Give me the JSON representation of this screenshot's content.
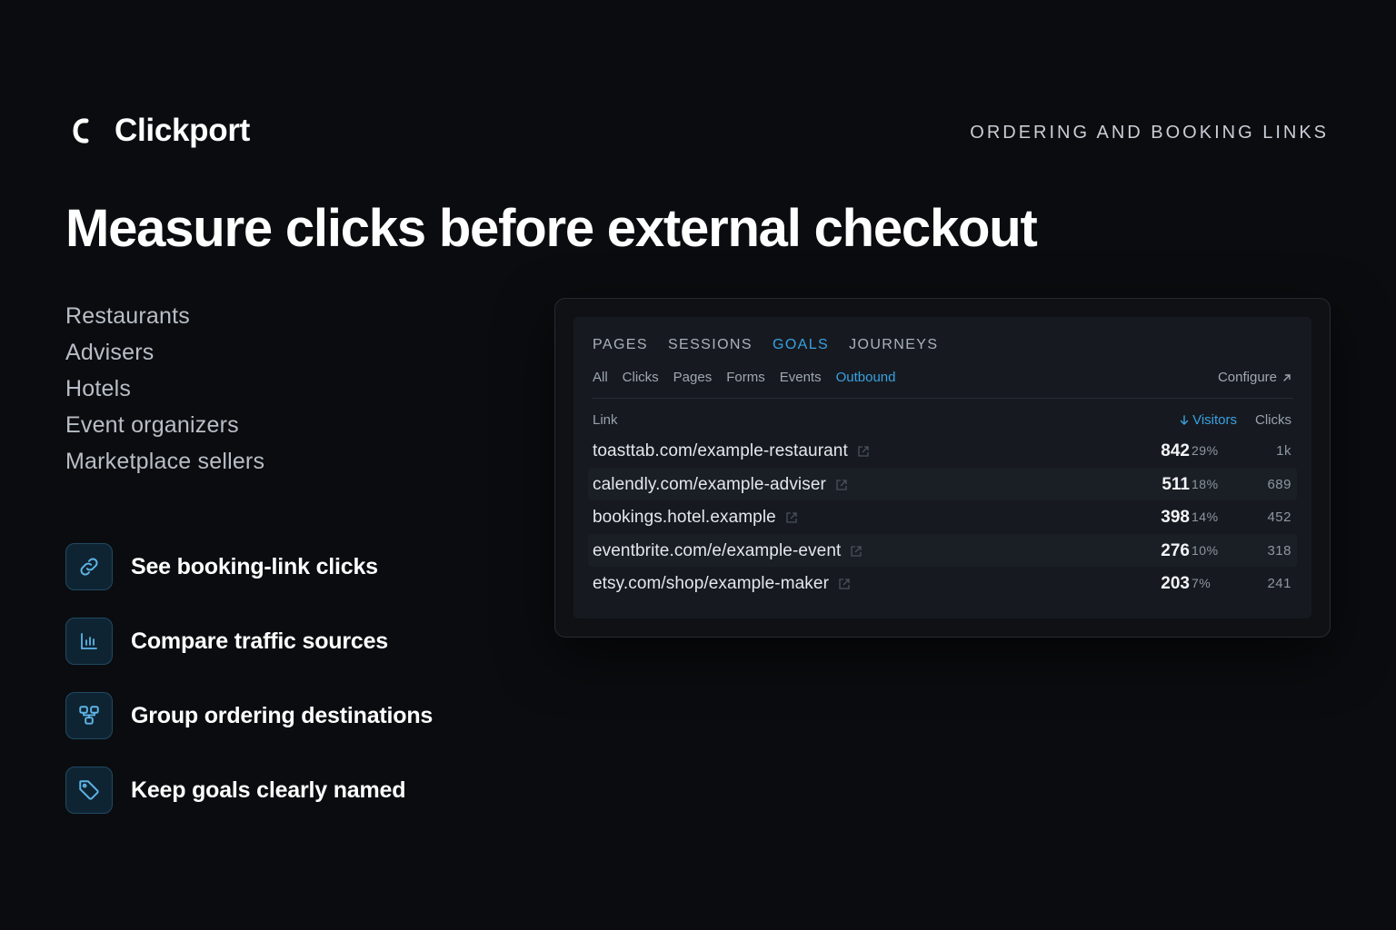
{
  "brand": {
    "name": "Clickport",
    "logo_icon": "c-logo-icon"
  },
  "top_tag": "ORDERING AND BOOKING LINKS",
  "headline": "Measure clicks before external checkout",
  "audiences": [
    "Restaurants",
    "Advisers",
    "Hotels",
    "Event organizers",
    "Marketplace sellers"
  ],
  "features": [
    {
      "icon": "link-icon",
      "label": "See booking-link clicks"
    },
    {
      "icon": "bar-chart-icon",
      "label": "Compare traffic sources"
    },
    {
      "icon": "group-icon",
      "label": "Group ordering destinations"
    },
    {
      "icon": "tag-icon",
      "label": "Keep goals clearly named"
    }
  ],
  "panel": {
    "tabs": [
      {
        "label": "PAGES",
        "active": false
      },
      {
        "label": "SESSIONS",
        "active": false
      },
      {
        "label": "GOALS",
        "active": true
      },
      {
        "label": "JOURNEYS",
        "active": false
      }
    ],
    "subtabs": [
      {
        "label": "All",
        "active": false
      },
      {
        "label": "Clicks",
        "active": false
      },
      {
        "label": "Pages",
        "active": false
      },
      {
        "label": "Forms",
        "active": false
      },
      {
        "label": "Events",
        "active": false
      },
      {
        "label": "Outbound",
        "active": true
      }
    ],
    "configure_label": "Configure",
    "columns": {
      "link": "Link",
      "visitors": "Visitors",
      "clicks": "Clicks"
    },
    "rows": [
      {
        "link": "toasttab.com/example-restaurant",
        "visitors": "842",
        "percent": "29%",
        "clicks": "1k"
      },
      {
        "link": "calendly.com/example-adviser",
        "visitors": "511",
        "percent": "18%",
        "clicks": "689"
      },
      {
        "link": "bookings.hotel.example",
        "visitors": "398",
        "percent": "14%",
        "clicks": "452"
      },
      {
        "link": "eventbrite.com/e/example-event",
        "visitors": "276",
        "percent": "10%",
        "clicks": "318"
      },
      {
        "link": "etsy.com/shop/example-maker",
        "visitors": "203",
        "percent": "7%",
        "clicks": "241"
      }
    ]
  },
  "colors": {
    "accent": "#3aa0e0",
    "background": "#0b0c0f",
    "panel": "#161a20"
  }
}
